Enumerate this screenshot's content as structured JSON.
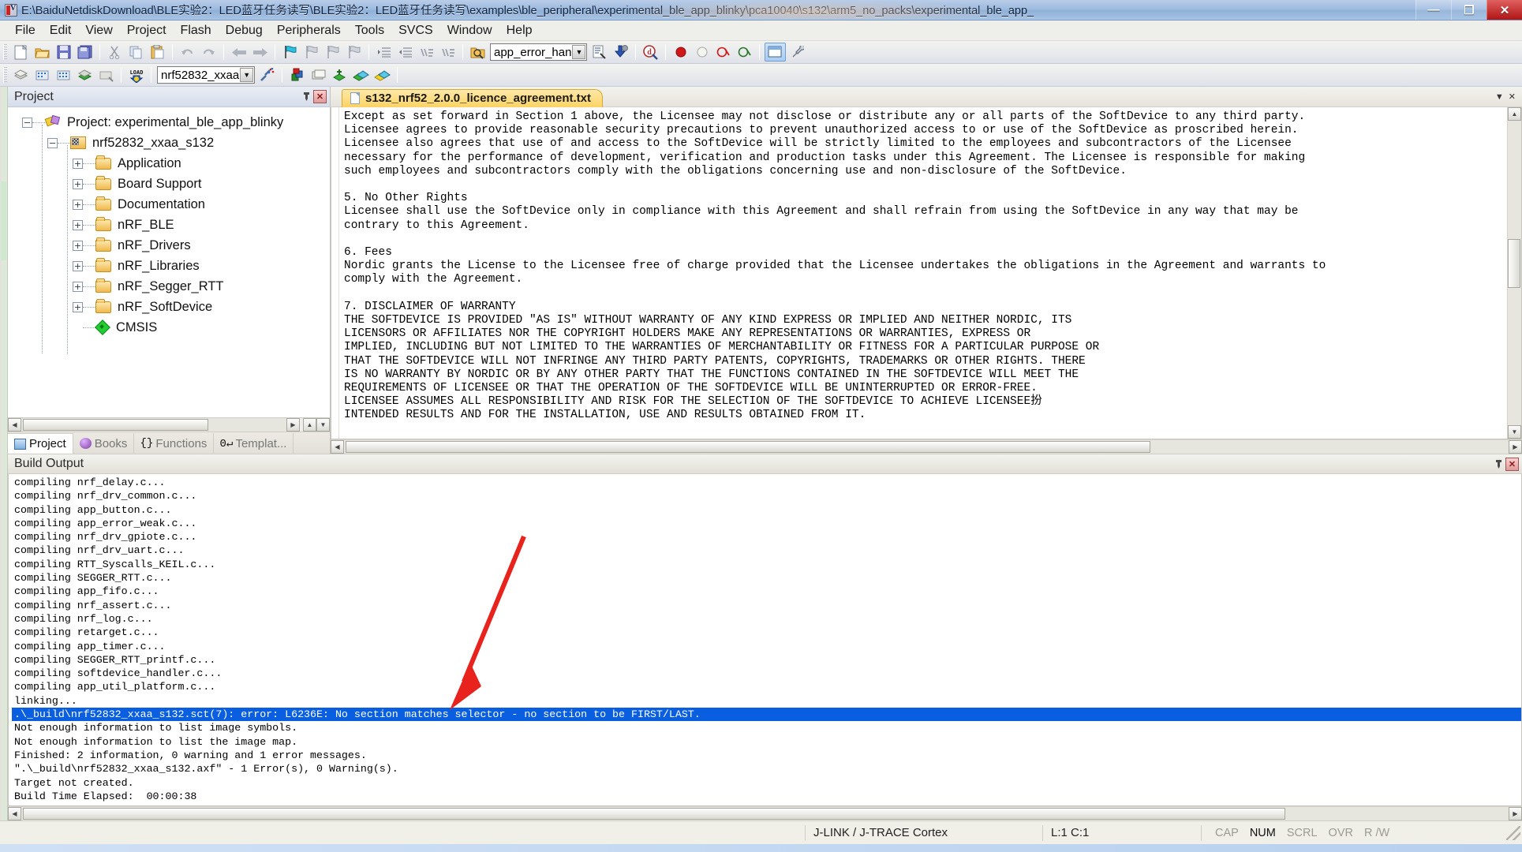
{
  "window": {
    "title": "E:\\BaiduNetdiskDownload\\BLE实验2：LED蓝牙任务读写\\BLE实验2：LED蓝牙任务读写\\examples\\ble_peripheral\\experimental_ble_app_blinky\\pca10040\\s132\\arm5_no_packs\\experimental_ble_app_",
    "minimize": "—",
    "maximize": "❐",
    "close": "✕"
  },
  "menu": {
    "items": [
      "File",
      "Edit",
      "View",
      "Project",
      "Flash",
      "Debug",
      "Peripherals",
      "Tools",
      "SVCS",
      "Window",
      "Help"
    ]
  },
  "toolbar1": {
    "find_combo_value": "app_error_han",
    "dropdown_arrow": "▼"
  },
  "toolbar2": {
    "target_combo_value": "nrf52832_xxaa",
    "dropdown_arrow": "▼"
  },
  "project_panel": {
    "title": "Project",
    "pin_icon": "📌",
    "close_icon": "✕",
    "tree": [
      {
        "label": "Project: experimental_ble_app_blinky",
        "icon": "project-icon",
        "expander": "−",
        "indent": 0
      },
      {
        "label": "nrf52832_xxaa_s132",
        "icon": "target-icon",
        "expander": "−",
        "indent": 1
      },
      {
        "label": "Application",
        "icon": "folder-icon",
        "expander": "+",
        "indent": 2
      },
      {
        "label": "Board Support",
        "icon": "folder-icon",
        "expander": "+",
        "indent": 2
      },
      {
        "label": "Documentation",
        "icon": "folder-icon",
        "expander": "+",
        "indent": 2
      },
      {
        "label": "nRF_BLE",
        "icon": "folder-icon",
        "expander": "+",
        "indent": 2
      },
      {
        "label": "nRF_Drivers",
        "icon": "folder-icon",
        "expander": "+",
        "indent": 2
      },
      {
        "label": "nRF_Libraries",
        "icon": "folder-icon",
        "expander": "+",
        "indent": 2
      },
      {
        "label": "nRF_Segger_RTT",
        "icon": "folder-icon",
        "expander": "+",
        "indent": 2
      },
      {
        "label": "nRF_SoftDevice",
        "icon": "folder-icon",
        "expander": "+",
        "indent": 2
      },
      {
        "label": "CMSIS",
        "icon": "cmsis-icon",
        "expander": "",
        "indent": 2
      }
    ],
    "tabs": [
      {
        "label": "Project",
        "icon": "project-tab-icon",
        "active": true
      },
      {
        "label": "Books",
        "icon": "books-tab-icon",
        "active": false
      },
      {
        "label": "Functions",
        "icon": "functions-tab-icon",
        "active": false
      },
      {
        "label": "Templat...",
        "icon": "templates-tab-icon",
        "active": false
      }
    ]
  },
  "editor": {
    "tab_label": "s132_nrf52_2.0.0_licence_agreement.txt",
    "tab_icon": "text-file-icon",
    "menu_chevron": "▼",
    "close_icon": "✕",
    "content": "Except as set forward in Section 1 above, the Licensee may not disclose or distribute any or all parts of the SoftDevice to any third party.\nLicensee agrees to provide reasonable security precautions to prevent unauthorized access to or use of the SoftDevice as proscribed herein.\nLicensee also agrees that use of and access to the SoftDevice will be strictly limited to the employees and subcontractors of the Licensee\nnecessary for the performance of development, verification and production tasks under this Agreement. The Licensee is responsible for making\nsuch employees and subcontractors comply with the obligations concerning use and non-disclosure of the SoftDevice.\n\n5. No Other Rights\nLicensee shall use the SoftDevice only in compliance with this Agreement and shall refrain from using the SoftDevice in any way that may be\ncontrary to this Agreement.\n\n6. Fees\nNordic grants the License to the Licensee free of charge provided that the Licensee undertakes the obligations in the Agreement and warrants to\ncomply with the Agreement.\n\n7. DISCLAIMER OF WARRANTY\nTHE SOFTDEVICE IS PROVIDED \"AS IS\" WITHOUT WARRANTY OF ANY KIND EXPRESS OR IMPLIED AND NEITHER NORDIC, ITS\nLICENSORS OR AFFILIATES NOR THE COPYRIGHT HOLDERS MAKE ANY REPRESENTATIONS OR WARRANTIES, EXPRESS OR\nIMPLIED, INCLUDING BUT NOT LIMITED TO THE WARRANTIES OF MERCHANTABILITY OR FITNESS FOR A PARTICULAR PURPOSE OR\nTHAT THE SOFTDEVICE WILL NOT INFRINGE ANY THIRD PARTY PATENTS, COPYRIGHTS, TRADEMARKS OR OTHER RIGHTS. THERE\nIS NO WARRANTY BY NORDIC OR BY ANY OTHER PARTY THAT THE FUNCTIONS CONTAINED IN THE SOFTDEVICE WILL MEET THE\nREQUIREMENTS OF LICENSEE OR THAT THE OPERATION OF THE SOFTDEVICE WILL BE UNINTERRUPTED OR ERROR-FREE.\nLICENSEE ASSUMES ALL RESPONSIBILITY AND RISK FOR THE SELECTION OF THE SOFTDEVICE TO ACHIEVE LICENSEE扮\nINTENDED RESULTS AND FOR THE INSTALLATION, USE AND RESULTS OBTAINED FROM IT."
  },
  "build_output": {
    "title": "Build Output",
    "pin_icon": "📌",
    "close_icon": "✕",
    "lines": [
      {
        "text": "compiling nrf_delay.c...",
        "error": false
      },
      {
        "text": "compiling nrf_drv_common.c...",
        "error": false
      },
      {
        "text": "compiling app_button.c...",
        "error": false
      },
      {
        "text": "compiling app_error_weak.c...",
        "error": false
      },
      {
        "text": "compiling nrf_drv_gpiote.c...",
        "error": false
      },
      {
        "text": "compiling nrf_drv_uart.c...",
        "error": false
      },
      {
        "text": "compiling RTT_Syscalls_KEIL.c...",
        "error": false
      },
      {
        "text": "compiling SEGGER_RTT.c...",
        "error": false
      },
      {
        "text": "compiling app_fifo.c...",
        "error": false
      },
      {
        "text": "compiling nrf_assert.c...",
        "error": false
      },
      {
        "text": "compiling nrf_log.c...",
        "error": false
      },
      {
        "text": "compiling retarget.c...",
        "error": false
      },
      {
        "text": "compiling app_timer.c...",
        "error": false
      },
      {
        "text": "compiling SEGGER_RTT_printf.c...",
        "error": false
      },
      {
        "text": "compiling softdevice_handler.c...",
        "error": false
      },
      {
        "text": "compiling app_util_platform.c...",
        "error": false
      },
      {
        "text": "linking...",
        "error": false
      },
      {
        "text": ".\\_build\\nrf52832_xxaa_s132.sct(7): error: L6236E: No section matches selector - no section to be FIRST/LAST.",
        "error": true
      },
      {
        "text": "Not enough information to list image symbols.",
        "error": false
      },
      {
        "text": "Not enough information to list the image map.",
        "error": false
      },
      {
        "text": "Finished: 2 information, 0 warning and 1 error messages.",
        "error": false
      },
      {
        "text": "\".\\_build\\nrf52832_xxaa_s132.axf\" - 1 Error(s), 0 Warning(s).",
        "error": false
      },
      {
        "text": "Target not created.",
        "error": false
      },
      {
        "text": "Build Time Elapsed:  00:00:38",
        "error": false
      }
    ]
  },
  "statusbar": {
    "debugger": "J-LINK / J-TRACE Cortex",
    "cursor_position": "L:1 C:1",
    "indicators": [
      {
        "label": "CAP",
        "on": false
      },
      {
        "label": "NUM",
        "on": true
      },
      {
        "label": "SCRL",
        "on": false
      },
      {
        "label": "OVR",
        "on": false
      },
      {
        "label": "R /W",
        "on": false
      }
    ]
  },
  "colors": {
    "error_highlight": "#0a5fe0",
    "tab_active": "#fcd263",
    "annotation_arrow": "#e8221c"
  }
}
